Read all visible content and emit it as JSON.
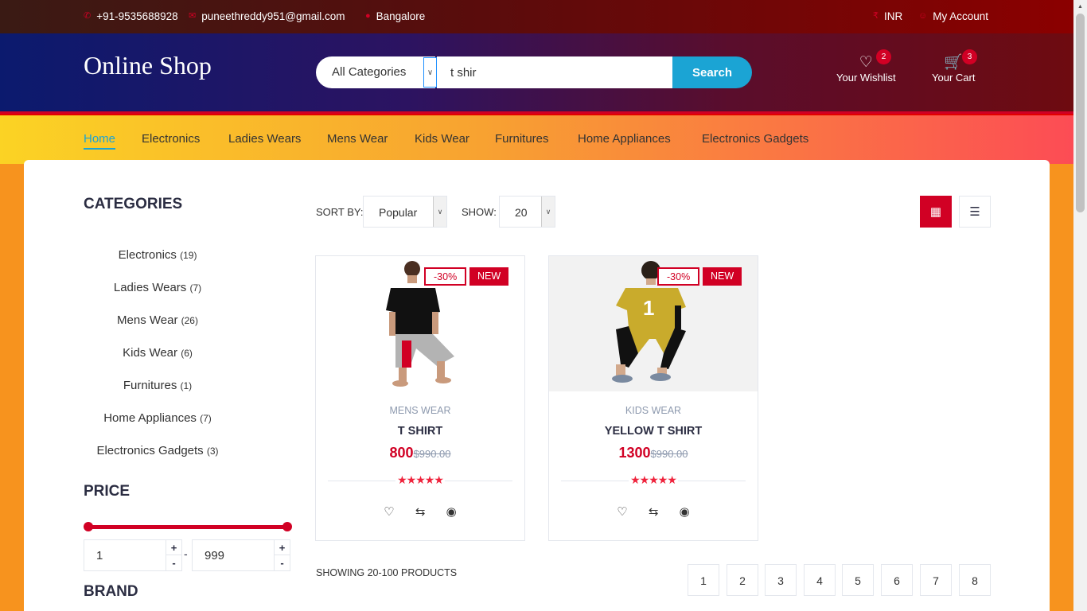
{
  "top_bar": {
    "phone": "+91-9535688928",
    "email": "puneethreddy951@gmail.com",
    "location": "Bangalore",
    "currency": "INR",
    "account": "My Account"
  },
  "header": {
    "logo": "Online Shop",
    "category_select": "All Categories",
    "search_value": "t shir",
    "search_button": "Search",
    "wishlist": {
      "label": "Your Wishlist",
      "qty": "2"
    },
    "cart": {
      "label": "Your Cart",
      "qty": "3"
    }
  },
  "nav": {
    "items": [
      "Home",
      "Electronics",
      "Ladies Wears",
      "Mens Wear",
      "Kids Wear",
      "Furnitures",
      "Home Appliances",
      "Electronics Gadgets"
    ],
    "active": "Home"
  },
  "aside": {
    "categories_title": "CATEGORIES",
    "categories": [
      {
        "name": "Electronics",
        "count": "(19)"
      },
      {
        "name": "Ladies Wears",
        "count": "(7)"
      },
      {
        "name": "Mens Wear",
        "count": "(26)"
      },
      {
        "name": "Kids Wear",
        "count": "(6)"
      },
      {
        "name": "Furnitures",
        "count": "(1)"
      },
      {
        "name": "Home Appliances",
        "count": "(7)"
      },
      {
        "name": "Electronics Gadgets",
        "count": "(3)"
      }
    ],
    "price_title": "PRICE",
    "price_min": "1",
    "price_max": "999",
    "price_separator": "-",
    "brand_title": "BRAND"
  },
  "store": {
    "sort_label": "SORT BY:",
    "sort_value": "Popular",
    "show_label": "SHOW:",
    "show_value": "20",
    "showing_text": "SHOWING 20-100 PRODUCTS",
    "pages": [
      "1",
      "2",
      "3",
      "4",
      "5",
      "6",
      "7",
      "8"
    ]
  },
  "products": [
    {
      "category": "MENS WEAR",
      "name": "T SHIRT",
      "price": "800",
      "old_price": "$990.00",
      "sale": "-30%",
      "new": "NEW",
      "rating": 5
    },
    {
      "category": "KIDS WEAR",
      "name": "YELLOW T SHIRT",
      "price": "1300",
      "old_price": "$990.00",
      "sale": "-30%",
      "new": "NEW",
      "rating": 5
    }
  ],
  "colors": {
    "accent": "#d10024",
    "search": "#1ba4d4",
    "active_nav": "#1ba4d4"
  },
  "icons": [
    "phone-icon",
    "mail-icon",
    "map-marker-icon",
    "rupee-icon",
    "user-icon",
    "heart-icon",
    "cart-icon",
    "grid-icon",
    "list-icon",
    "exchange-icon",
    "eye-icon",
    "star-icon",
    "chevron-down-icon"
  ]
}
